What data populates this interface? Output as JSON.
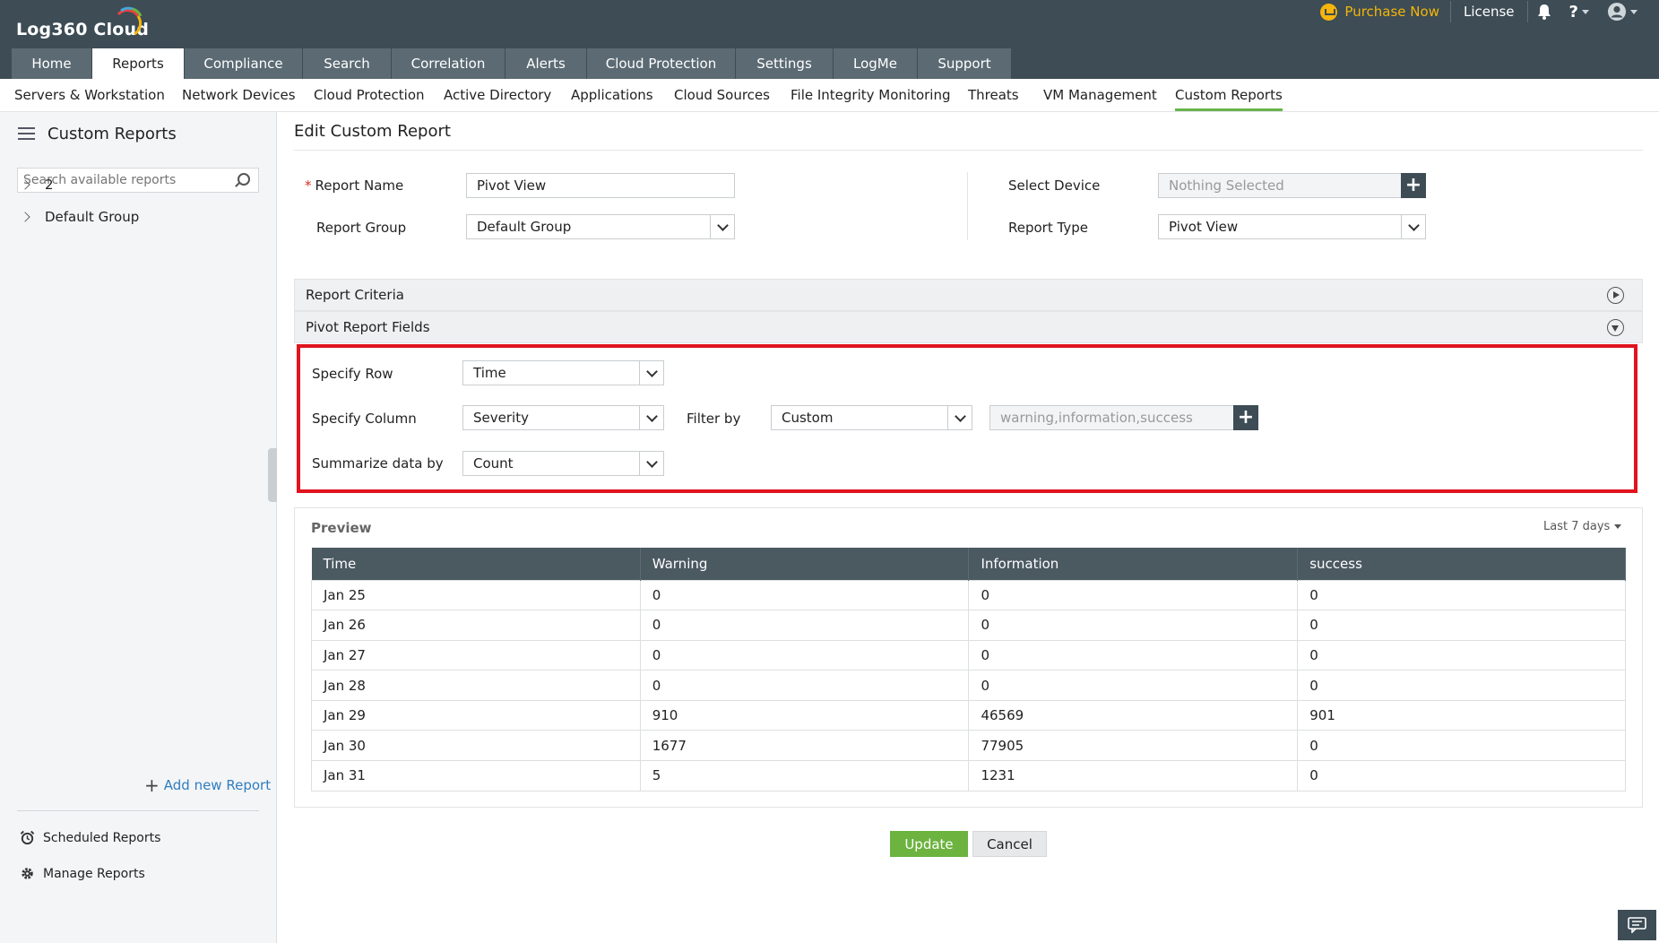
{
  "header": {
    "logo_text": "Log360 Cloud",
    "purchase_label": "Purchase Now",
    "license_label": "License",
    "help_label": "?",
    "icons": [
      "cart-icon",
      "bell-icon",
      "help-icon",
      "user-icon"
    ],
    "accent_color": "#f5b50a"
  },
  "main_tabs": [
    {
      "label": "Home"
    },
    {
      "label": "Reports",
      "active": true
    },
    {
      "label": "Compliance"
    },
    {
      "label": "Search"
    },
    {
      "label": "Correlation"
    },
    {
      "label": "Alerts"
    },
    {
      "label": "Cloud Protection"
    },
    {
      "label": "Settings"
    },
    {
      "label": "LogMe"
    },
    {
      "label": "Support"
    }
  ],
  "sub_nav": [
    {
      "label": "Servers & Workstation"
    },
    {
      "label": "Network Devices"
    },
    {
      "label": "Cloud Protection"
    },
    {
      "label": "Active Directory"
    },
    {
      "label": "Applications"
    },
    {
      "label": "Cloud Sources"
    },
    {
      "label": "File Integrity Monitoring"
    },
    {
      "label": "Threats"
    },
    {
      "label": "VM Management"
    },
    {
      "label": "Custom Reports",
      "active": true
    }
  ],
  "sidebar": {
    "title": "Custom Reports",
    "search_placeholder": "Search available reports",
    "tree": [
      {
        "label": "2"
      },
      {
        "label": "Default Group"
      }
    ],
    "add_report": "Add new Report",
    "scheduled_reports": "Scheduled Reports",
    "manage_reports": "Manage Reports"
  },
  "form": {
    "page_title": "Edit Custom Report",
    "required_mark": "*",
    "report_name_label": "Report Name",
    "report_name_value": "Pivot View",
    "report_group_label": "Report Group",
    "report_group_value": "Default Group",
    "select_device_label": "Select Device",
    "select_device_value": "Nothing Selected",
    "report_type_label": "Report Type",
    "report_type_value": "Pivot View"
  },
  "sections": {
    "criteria": "Report Criteria",
    "pivot_fields": "Pivot Report Fields"
  },
  "pivot": {
    "row_label": "Specify Row",
    "row_value": "Time",
    "column_label": "Specify Column",
    "column_value": "Severity",
    "filter_label": "Filter by",
    "filter_value": "Custom",
    "filter_values": "warning,information,success",
    "summarize_label": "Summarize data by",
    "summarize_value": "Count",
    "highlight_color": "#e0141e"
  },
  "preview": {
    "title": "Preview",
    "range": "Last 7 days",
    "columns": [
      "Time",
      "Warning",
      "Information",
      "success"
    ],
    "rows": [
      [
        "Jan 25",
        "0",
        "0",
        "0"
      ],
      [
        "Jan 26",
        "0",
        "0",
        "0"
      ],
      [
        "Jan 27",
        "0",
        "0",
        "0"
      ],
      [
        "Jan 28",
        "0",
        "0",
        "0"
      ],
      [
        "Jan 29",
        "910",
        "46569",
        "901"
      ],
      [
        "Jan 30",
        "1677",
        "77905",
        "0"
      ],
      [
        "Jan 31",
        "5",
        "1231",
        "0"
      ]
    ]
  },
  "actions": {
    "update": "Update",
    "cancel": "Cancel",
    "update_color": "#6cb33f"
  }
}
